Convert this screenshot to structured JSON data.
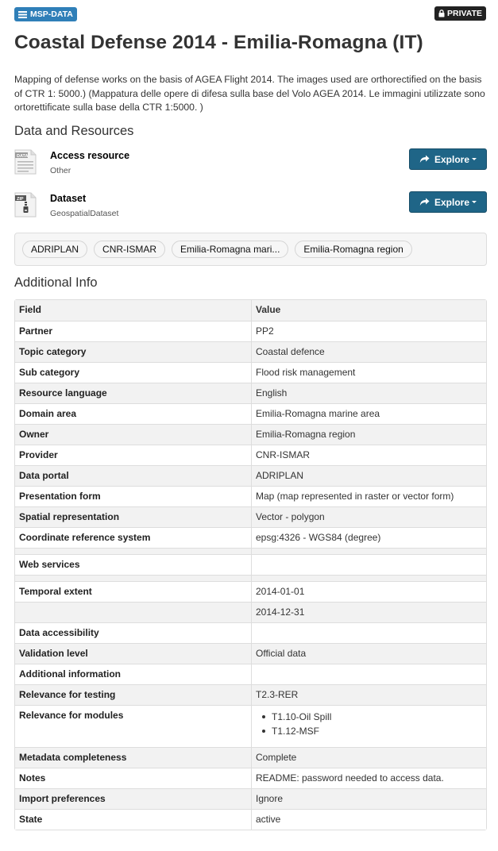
{
  "header": {
    "org_badge": "MSP-DATA",
    "private_badge": "PRIVATE"
  },
  "dataset": {
    "title": "Coastal Defense 2014 - Emilia-Romagna (IT)",
    "notes": "Mapping of defense works on the basis of AGEA Flight 2014. The images used are orthorectified on the basis of CTR 1: 5000.) (Mappatura delle opere di difesa sulla base del Volo AGEA 2014. Le immagini utilizzate sono ortorettificate sulla base della CTR 1:5000. )"
  },
  "resources": {
    "heading": "Data and Resources",
    "items": [
      {
        "icon_text": "DATA",
        "title": "Access resource",
        "format": "Other",
        "button": "Explore"
      },
      {
        "icon_text": "ZIP",
        "title": "Dataset",
        "format": "GeospatialDataset",
        "button": "Explore"
      }
    ]
  },
  "tags": [
    "ADRIPLAN",
    "CNR-ISMAR",
    "Emilia-Romagna mari...",
    "Emilia-Romagna region"
  ],
  "additional_info": {
    "heading": "Additional Info",
    "columns": [
      "Field",
      "Value"
    ],
    "rows": [
      {
        "field": "Partner",
        "value": "PP2"
      },
      {
        "field": "Topic category",
        "value": "Coastal defence"
      },
      {
        "field": "Sub category",
        "value": "Flood risk management"
      },
      {
        "field": "Resource language",
        "value": "English"
      },
      {
        "field": "Domain area",
        "value": "Emilia-Romagna marine area"
      },
      {
        "field": "Owner",
        "value": "Emilia-Romagna region"
      },
      {
        "field": "Provider",
        "value": "CNR-ISMAR"
      },
      {
        "field": "Data portal",
        "value": "ADRIPLAN"
      },
      {
        "field": "Presentation form",
        "value": "Map (map represented in raster or vector form)"
      },
      {
        "field": "Spatial representation",
        "value": "Vector - polygon"
      },
      {
        "field": "Coordinate reference system",
        "value": "epsg:4326 - WGS84 (degree)"
      },
      {
        "field": "",
        "value": ""
      },
      {
        "field": "Web services",
        "value": ""
      },
      {
        "field": "",
        "value": ""
      },
      {
        "field": "Temporal extent",
        "value": "2014-01-01"
      },
      {
        "field": "",
        "value": "2014-12-31"
      },
      {
        "field": "Data accessibility",
        "value": ""
      },
      {
        "field": "Validation level",
        "value": "Official data"
      },
      {
        "field": "Additional information",
        "value": ""
      },
      {
        "field": "Relevance for testing",
        "value": "T2.3-RER"
      },
      {
        "field": "Relevance for modules",
        "list": [
          "T1.10-Oil Spill",
          "T1.12-MSF"
        ]
      },
      {
        "field": "Metadata completeness",
        "value": "Complete"
      },
      {
        "field": "Notes",
        "value": "README: password needed to access data."
      },
      {
        "field": "Import preferences",
        "value": "Ignore"
      },
      {
        "field": "State",
        "value": "active"
      }
    ]
  }
}
